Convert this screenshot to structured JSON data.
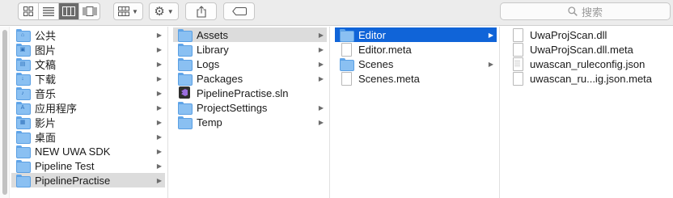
{
  "toolbar": {
    "view_modes": [
      "icon-view",
      "list-view",
      "column-view",
      "gallery-view"
    ],
    "active_view": "column-view",
    "search_placeholder": "搜索"
  },
  "sidebar": {
    "items": [
      {
        "label": "公共",
        "icon": "folder-icon",
        "has_children": true,
        "selected": false
      },
      {
        "label": "图片",
        "icon": "folder-icon",
        "has_children": true,
        "selected": false
      },
      {
        "label": "文稿",
        "icon": "folder-icon",
        "has_children": true,
        "selected": false
      },
      {
        "label": "下载",
        "icon": "folder-icon",
        "has_children": true,
        "selected": false
      },
      {
        "label": "音乐",
        "icon": "folder-icon",
        "has_children": true,
        "selected": false
      },
      {
        "label": "应用程序",
        "icon": "folder-icon",
        "has_children": true,
        "selected": false
      },
      {
        "label": "影片",
        "icon": "folder-icon",
        "has_children": true,
        "selected": false
      },
      {
        "label": "桌面",
        "icon": "folder-icon",
        "has_children": true,
        "selected": false
      },
      {
        "label": "NEW UWA SDK",
        "icon": "folder-icon",
        "has_children": true,
        "selected": false
      },
      {
        "label": "Pipeline Test",
        "icon": "folder-icon",
        "has_children": true,
        "selected": false
      },
      {
        "label": "PipelinePractise",
        "icon": "folder-icon",
        "has_children": true,
        "selected": true
      }
    ]
  },
  "column2": {
    "items": [
      {
        "label": "Assets",
        "icon": "folder-icon",
        "has_children": true,
        "selected": true
      },
      {
        "label": "Library",
        "icon": "folder-icon",
        "has_children": true,
        "selected": false
      },
      {
        "label": "Logs",
        "icon": "folder-icon",
        "has_children": true,
        "selected": false
      },
      {
        "label": "Packages",
        "icon": "folder-icon",
        "has_children": true,
        "selected": false
      },
      {
        "label": "PipelinePractise.sln",
        "icon": "visual-studio-solution-icon",
        "has_children": false,
        "selected": false
      },
      {
        "label": "ProjectSettings",
        "icon": "folder-icon",
        "has_children": true,
        "selected": false
      },
      {
        "label": "Temp",
        "icon": "folder-icon",
        "has_children": true,
        "selected": false
      }
    ]
  },
  "column3": {
    "items": [
      {
        "label": "Editor",
        "icon": "folder-icon",
        "has_children": true,
        "selected": true
      },
      {
        "label": "Editor.meta",
        "icon": "document-icon",
        "has_children": false,
        "selected": false
      },
      {
        "label": "Scenes",
        "icon": "folder-icon",
        "has_children": true,
        "selected": false
      },
      {
        "label": "Scenes.meta",
        "icon": "document-icon",
        "has_children": false,
        "selected": false
      }
    ]
  },
  "column4": {
    "items": [
      {
        "label": "UwaProjScan.dll",
        "icon": "document-icon"
      },
      {
        "label": "UwaProjScan.dll.meta",
        "icon": "document-icon"
      },
      {
        "label": "uwascan_ruleconfig.json",
        "icon": "text-document-icon"
      },
      {
        "label": "uwascan_ru...ig.json.meta",
        "icon": "document-icon"
      }
    ]
  },
  "colors": {
    "selection_active": "#1064d8",
    "selection_inactive": "#dcdcdc",
    "folder": "#8ac0f2"
  }
}
